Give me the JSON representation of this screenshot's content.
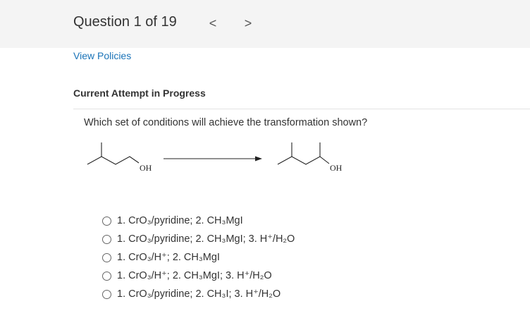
{
  "header": {
    "question_title": "Question 1 of 19",
    "prev_label": "<",
    "next_label": ">"
  },
  "links": {
    "view_policies": "View Policies"
  },
  "section": {
    "attempt_label": "Current Attempt in Progress"
  },
  "question": {
    "text": "Which set of conditions will achieve the transformation shown?",
    "reactant_label": "OH",
    "product_label": "OH"
  },
  "options": [
    "1. CrO₃/pyridine; 2. CH₃MgI",
    "1. CrO₃/pyridine; 2. CH₃MgI; 3. H⁺/H₂O",
    "1. CrO₃/H⁺; 2. CH₃MgI",
    "1. CrO₃/H⁺; 2. CH₃MgI; 3. H⁺/H₂O",
    "1. CrO₃/pyridine; 2. CH₃I; 3. H⁺/H₂O"
  ],
  "icons": {
    "prev": "chevron-left-icon",
    "next": "chevron-right-icon",
    "radio": "radio-empty-icon"
  }
}
